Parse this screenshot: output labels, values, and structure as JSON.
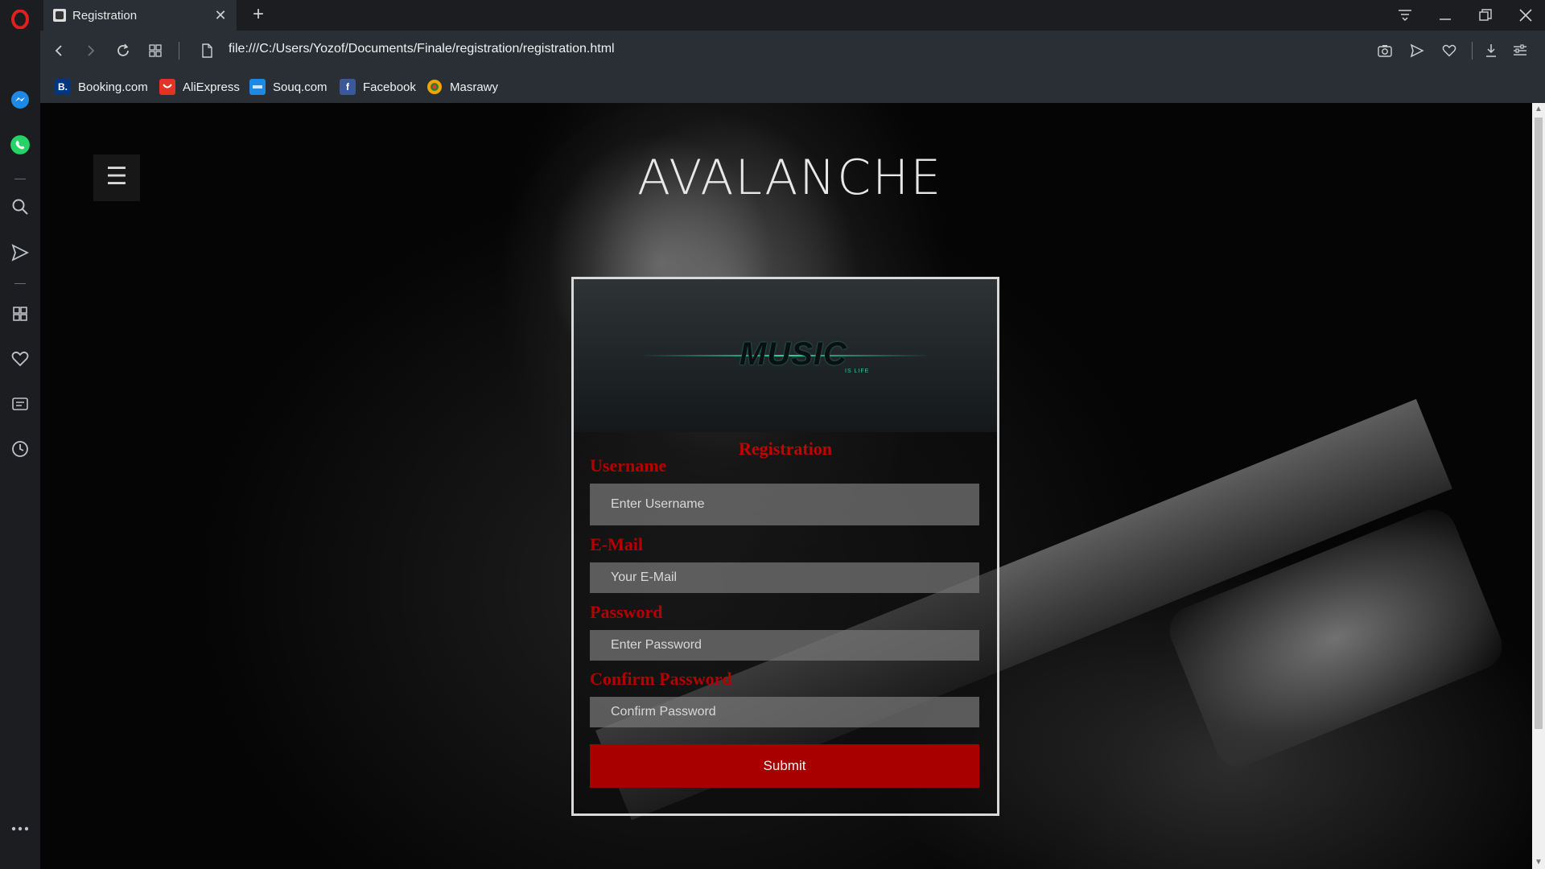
{
  "browser": {
    "tab_title": "Registration",
    "tab_close": "✕",
    "new_tab": "+",
    "url": "file:///C:/Users/Yozof/Documents/Finale/registration/registration.html"
  },
  "bookmarks": [
    {
      "label": "Booking.com",
      "icon": "booking-icon",
      "badge": "B.",
      "color": "#003580"
    },
    {
      "label": "AliExpress",
      "icon": "aliexpress-icon",
      "badge": "",
      "color": "#e43225"
    },
    {
      "label": "Souq.com",
      "icon": "souq-icon",
      "badge": "",
      "color": "#1e88e5"
    },
    {
      "label": "Facebook",
      "icon": "facebook-icon",
      "badge": "f",
      "color": "#3b5998"
    },
    {
      "label": "Masrawy",
      "icon": "masrawy-icon",
      "badge": "",
      "color": "#f0a500"
    }
  ],
  "page": {
    "menu_glyph": "☰",
    "brand": "AVALANCHE",
    "logo": {
      "text": "MUSIC",
      "sub": "IS LIFE"
    },
    "form": {
      "title": "Registration",
      "username_label": "Username",
      "username_placeholder": "Enter Username",
      "email_label": "E-Mail",
      "email_placeholder": "Your E-Mail",
      "password_label": "Password",
      "password_placeholder": "Enter Password",
      "confirm_label": "Confirm Password",
      "confirm_placeholder": "Confirm Password",
      "submit_label": "Submit"
    }
  },
  "colors": {
    "accent_red": "#b40000",
    "submit_bg": "#a80000",
    "logo_teal": "#2bd3b0"
  }
}
